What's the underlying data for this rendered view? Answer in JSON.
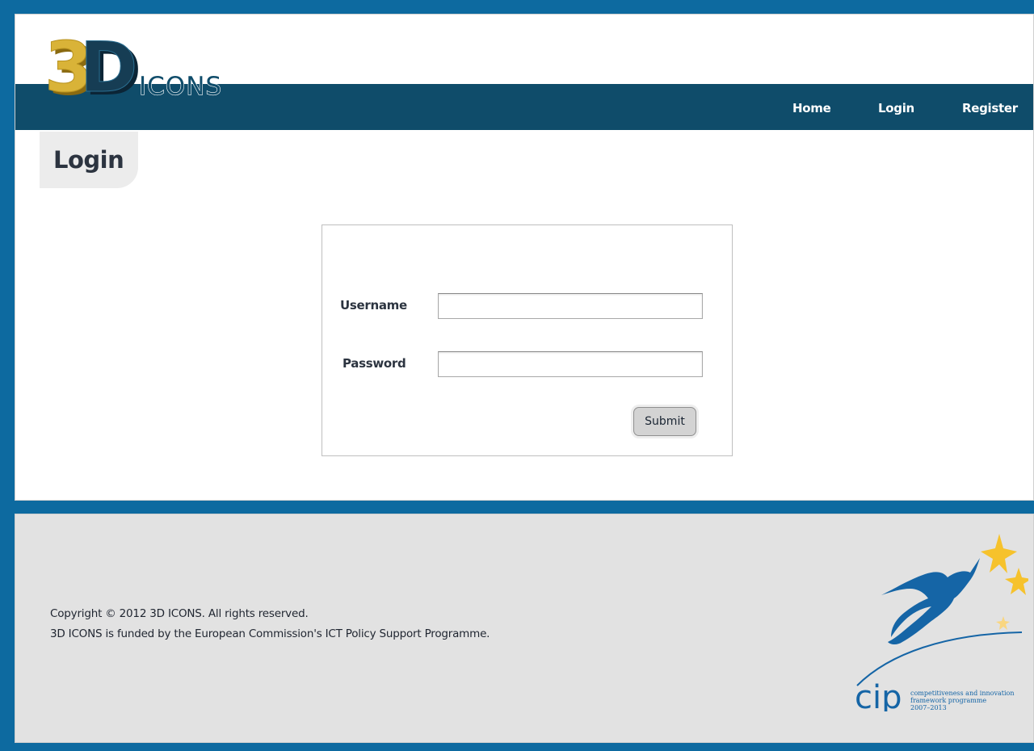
{
  "header": {
    "logo": {
      "mark": "3D",
      "wordmark": "ICONS"
    },
    "nav": [
      {
        "label": "Home"
      },
      {
        "label": "Login"
      },
      {
        "label": "Register"
      }
    ]
  },
  "main": {
    "title": "Login",
    "form": {
      "username_label": "Username",
      "username_value": "",
      "password_label": "Password",
      "password_value": "",
      "submit_label": "Submit"
    }
  },
  "footer": {
    "copyright": "Copyright © 2012 3D ICONS. All rights reserved.",
    "funding": "3D ICONS is funded by the European Commission's ICT Policy Support Programme.",
    "cip_logo": {
      "acronym": "cip",
      "line1": "competitiveness and innovation",
      "line2": "framework programme",
      "years": "2007–2013"
    }
  },
  "colors": {
    "page_background": "#0d6aa0",
    "navbar": "#0f4c6a",
    "logo_gold": "#d9b338",
    "logo_navy": "#163d54",
    "footer_background": "#e2e2e2",
    "cip_blue": "#1565a6",
    "star_yellow": "#f6c22c"
  }
}
